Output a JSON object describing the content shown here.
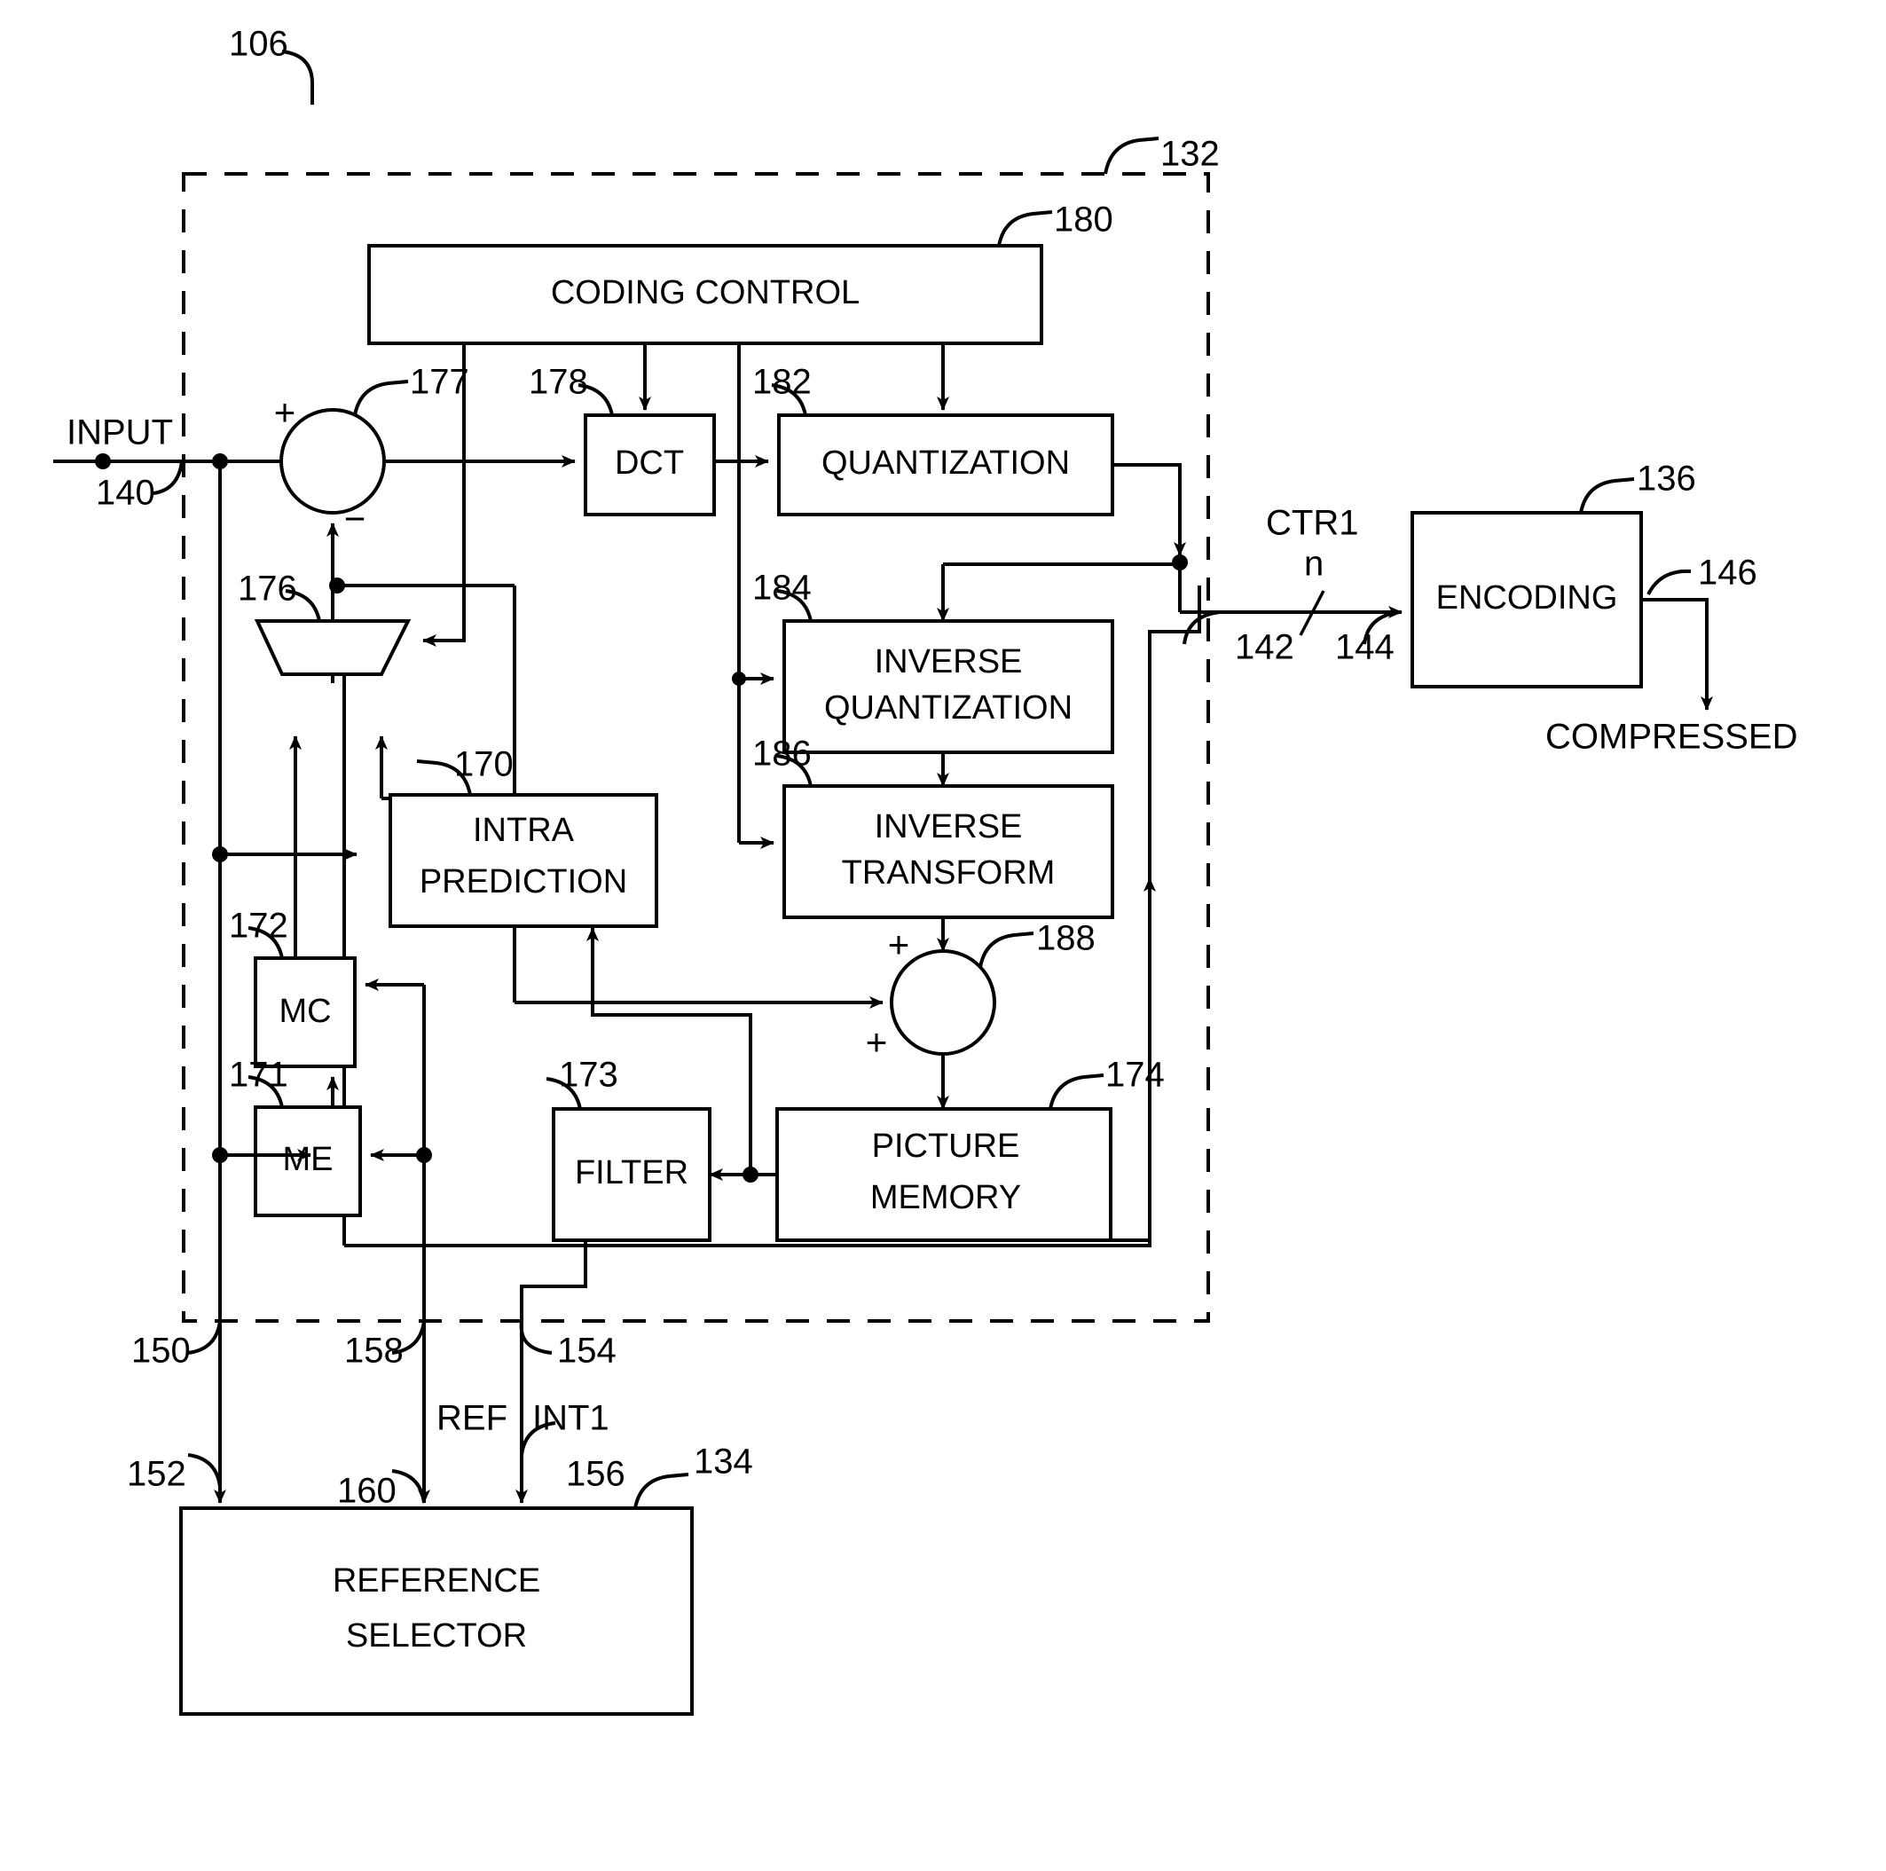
{
  "figure": {
    "top_ref": "106",
    "dashed_region_ref": "132"
  },
  "blocks": {
    "coding_control": {
      "label": "CODING CONTROL",
      "ref": "180"
    },
    "dct": {
      "label": "DCT",
      "ref": "178"
    },
    "quantization": {
      "label": "QUANTIZATION",
      "ref": "182"
    },
    "inverse_quantization": {
      "label_line1": "INVERSE",
      "label_line2": "QUANTIZATION",
      "ref": "184"
    },
    "inverse_transform": {
      "label_line1": "INVERSE",
      "label_line2": "TRANSFORM",
      "ref": "186"
    },
    "intra_prediction": {
      "label_line1": "INTRA",
      "label_line2": "PREDICTION",
      "ref": "170"
    },
    "mc": {
      "label": "MC",
      "ref": "172"
    },
    "me": {
      "label": "ME",
      "ref": "171"
    },
    "filter": {
      "label": "FILTER",
      "ref": "173"
    },
    "picture_memory": {
      "label_line1": "PICTURE",
      "label_line2": "MEMORY",
      "ref": "174"
    },
    "encoding": {
      "label": "ENCODING",
      "ref": "136"
    },
    "reference_selector": {
      "label_line1": "REFERENCE",
      "label_line2": "SELECTOR",
      "ref": "134"
    },
    "mux": {
      "ref": "176"
    },
    "summer_input": {
      "ref": "177",
      "plus": "+",
      "minus": "−"
    },
    "summer_recon": {
      "ref": "188",
      "plus_top": "+",
      "plus_left": "+"
    }
  },
  "signals": {
    "input": "INPUT",
    "input_ref": "140",
    "compressed": "COMPRESSED",
    "ctr1_line1": "CTR1",
    "ctr1_line2": "n",
    "bus_142": "142",
    "bus_144": "144",
    "out_146": "146",
    "ref_150": "150",
    "ref_152": "152",
    "ref_154": "154",
    "ref_156": "156",
    "ref_158": "158",
    "ref_160": "160",
    "label_ref": "REF",
    "label_int1": "INT1"
  }
}
